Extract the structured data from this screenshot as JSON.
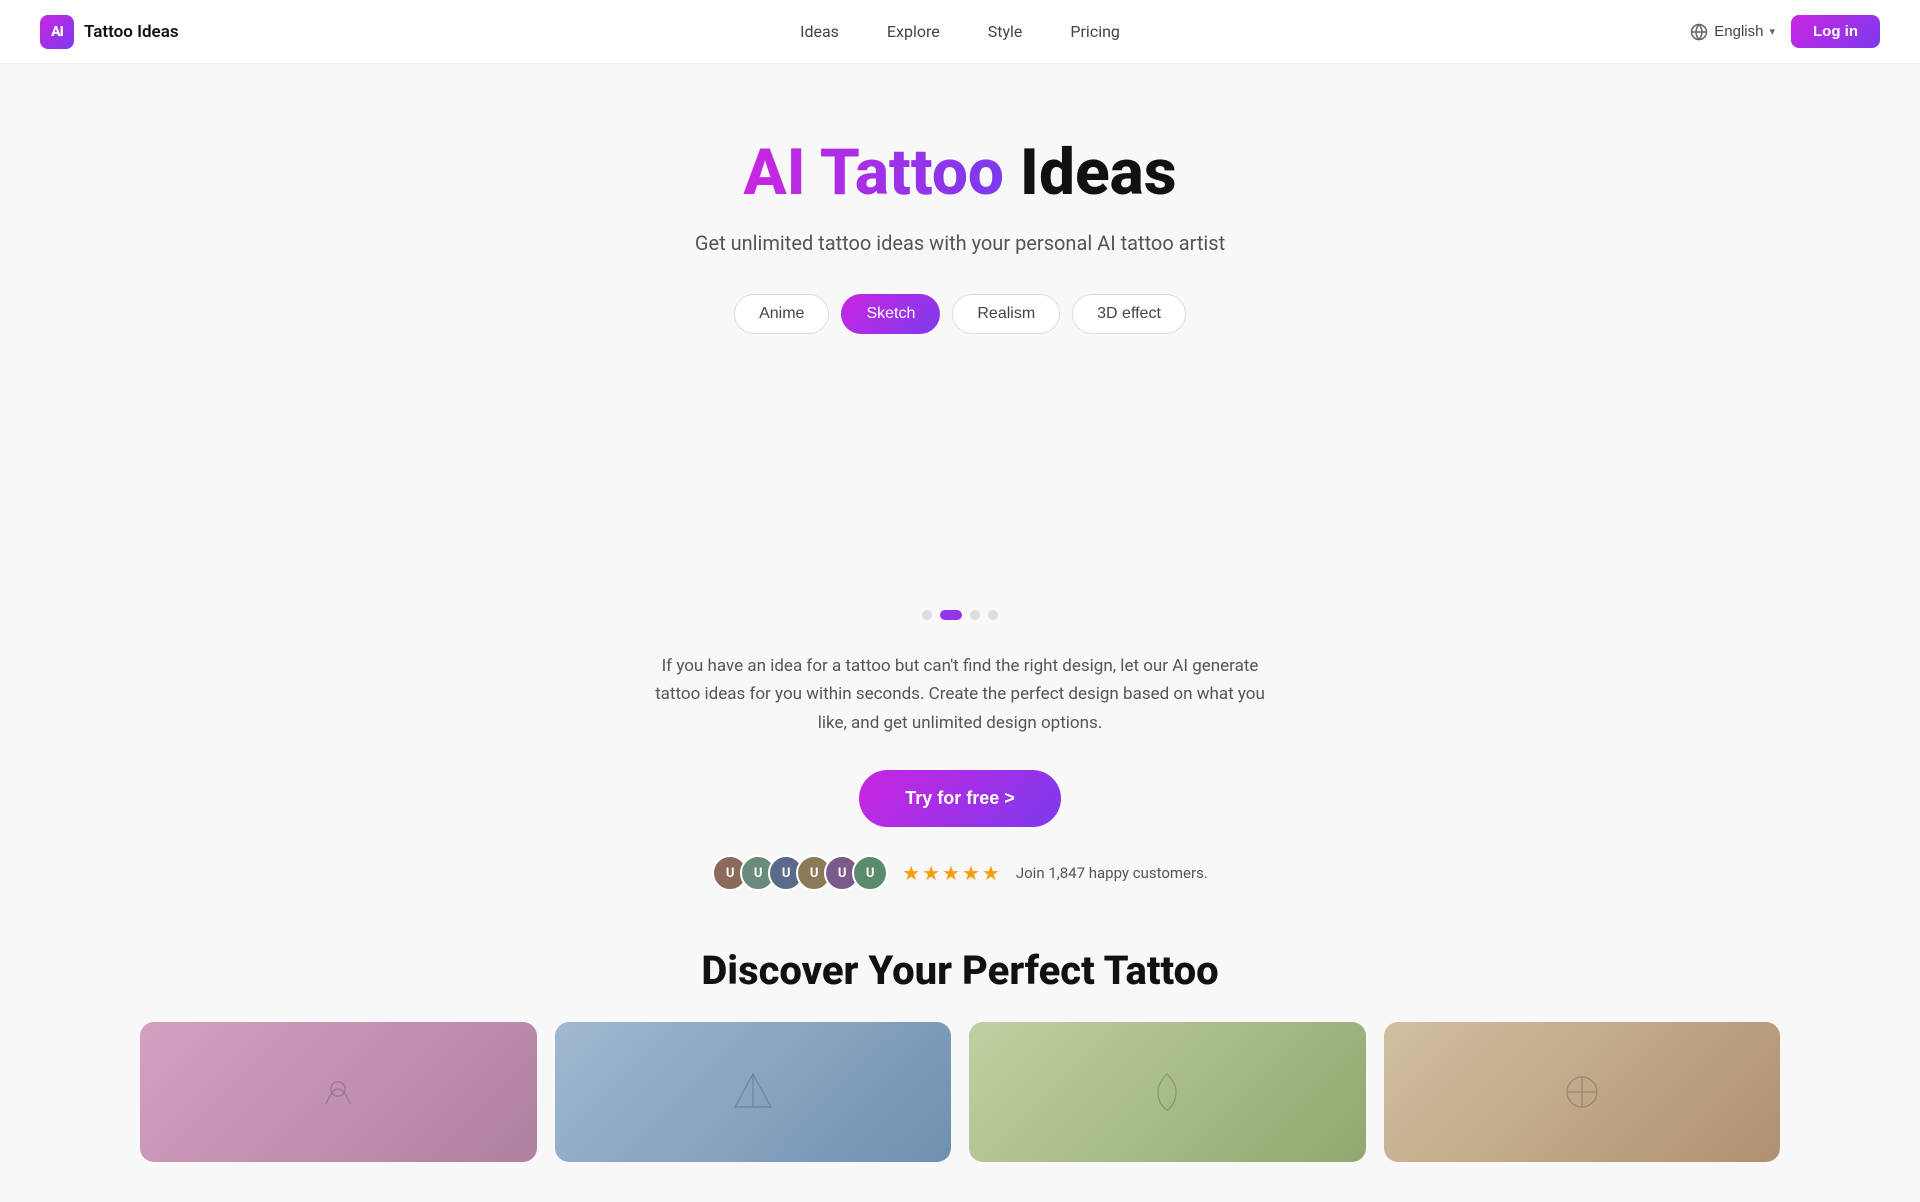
{
  "logo": {
    "icon_text": "AI",
    "brand_name": "Tattoo Ideas"
  },
  "nav": {
    "items": [
      {
        "label": "Ideas",
        "id": "ideas"
      },
      {
        "label": "Explore",
        "id": "explore"
      },
      {
        "label": "Style",
        "id": "style"
      },
      {
        "label": "Pricing",
        "id": "pricing"
      }
    ]
  },
  "header": {
    "language": "English",
    "login_label": "Log in"
  },
  "hero": {
    "title_gradient": "AI Tattoo",
    "title_plain": " Ideas",
    "subtitle": "Get unlimited tattoo ideas with your personal AI tattoo artist"
  },
  "style_pills": [
    {
      "label": "Anime",
      "active": false
    },
    {
      "label": "Sketch",
      "active": true
    },
    {
      "label": "Realism",
      "active": false
    },
    {
      "label": "3D effect",
      "active": false
    }
  ],
  "carousel": {
    "dots": [
      false,
      true,
      false,
      false
    ]
  },
  "description": "If you have an idea for a tattoo but can't find the right design, let our AI generate tattoo ideas for you within seconds. Create the perfect design based on what you like, and get unlimited design options.",
  "cta": {
    "label": "Try for free >"
  },
  "social_proof": {
    "stars": "★★★★★",
    "text": "Join 1,847 happy customers."
  },
  "discover": {
    "title": "Discover Your Perfect Tattoo"
  }
}
